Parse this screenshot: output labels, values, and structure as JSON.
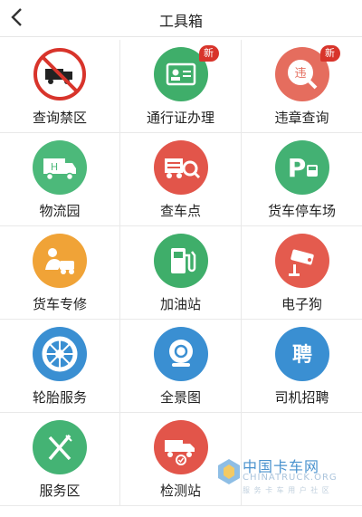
{
  "header": {
    "title": "工具箱",
    "back_icon": "back-icon"
  },
  "badge_label": "新",
  "items": [
    {
      "label": "查询禁区",
      "icon": "no-truck-icon",
      "color": "#ffffff",
      "badge": false
    },
    {
      "label": "通行证办理",
      "icon": "id-card-icon",
      "color": "#3fae6a",
      "badge": true
    },
    {
      "label": "违章查询",
      "icon": "violation-search-icon",
      "color": "#e56d5e",
      "badge": true
    },
    {
      "label": "物流园",
      "icon": "logistics-truck-icon",
      "color": "#4cb97a",
      "badge": false
    },
    {
      "label": "查车点",
      "icon": "truck-search-icon",
      "color": "#e2554a",
      "badge": false
    },
    {
      "label": "货车停车场",
      "icon": "parking-icon",
      "color": "#43b173",
      "badge": false
    },
    {
      "label": "货车专修",
      "icon": "repair-icon",
      "color": "#f0a337",
      "badge": false
    },
    {
      "label": "加油站",
      "icon": "fuel-pump-icon",
      "color": "#3fae6a",
      "badge": false
    },
    {
      "label": "电子狗",
      "icon": "camera-icon",
      "color": "#e45b4e",
      "badge": false
    },
    {
      "label": "轮胎服务",
      "icon": "tire-icon",
      "color": "#3a8fd2",
      "badge": false
    },
    {
      "label": "全景图",
      "icon": "panorama-camera-icon",
      "color": "#3a8fd2",
      "badge": false
    },
    {
      "label": "司机招聘",
      "icon": "recruit-icon",
      "color": "#3a8fd2",
      "badge": false
    },
    {
      "label": "服务区",
      "icon": "fork-knife-icon",
      "color": "#44b374",
      "badge": false
    },
    {
      "label": "检测站",
      "icon": "inspection-truck-icon",
      "color": "#e2554a",
      "badge": false
    }
  ],
  "recruit_glyph": "聘",
  "watermark": {
    "cn": "中国卡车网",
    "en": "CHINATRUCK.ORG",
    "sub": "服 务 卡 车 用 户 社 区"
  }
}
